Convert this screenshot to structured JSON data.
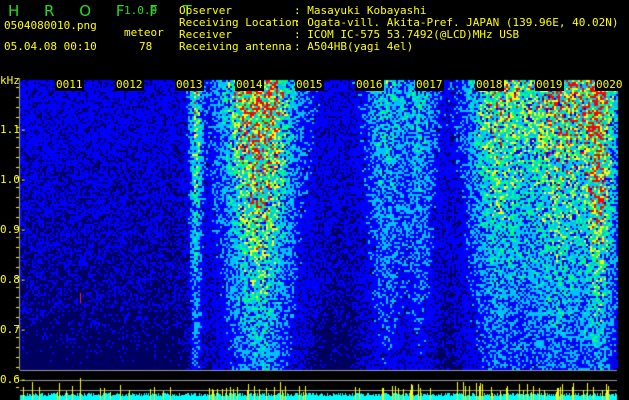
{
  "header": {
    "app_name": "H R O F F T",
    "version": "1.0.0",
    "filename": "0504080010.png",
    "datetime": "05.04.08 00:10",
    "meteor_label": "meteor",
    "meteor_count": "78",
    "observer_label": "Observer",
    "observer": ": Masayuki Kobayashi",
    "location_label": "Receiving Location",
    "location": ": Ogata-vill. Akita-Pref. JAPAN (139.96E, 40.02N)",
    "receiver_label": "Receiver",
    "receiver": ": ICOM IC-575 53.7492(@LCD)MHz USB",
    "antenna_label": "Receiving antenna",
    "antenna": ": A504HB(yagi 4el)"
  },
  "chart_data": {
    "type": "heatmap",
    "ylabel": "kHz",
    "y_ticks": [
      "1.1",
      "1.0",
      "0.9",
      "0.8",
      "0.7",
      "0.6"
    ],
    "ylim": [
      0.58,
      1.16
    ],
    "x_ticks": [
      "0011",
      "0012",
      "0013",
      "0014",
      "0015",
      "0016",
      "0017",
      "0018",
      "0019",
      "0020"
    ],
    "colormap": [
      "#000060",
      "#0000ff",
      "#00c0ff",
      "#00ff80",
      "#ffff00",
      "#ff0000"
    ],
    "bottom_panel_colors": {
      "level": "#00ffff",
      "meteor_spikes": "#ffff00"
    }
  }
}
